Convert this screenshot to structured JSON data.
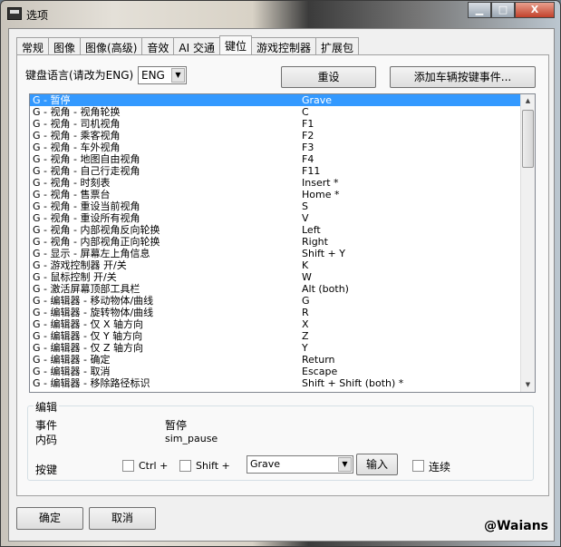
{
  "window": {
    "title": "选项",
    "minimize": "▁",
    "maximize": "□",
    "close": "X"
  },
  "tabs": [
    "常规",
    "图像",
    "图像(高级)",
    "音效",
    "AI 交通",
    "键位",
    "游戏控制器",
    "扩展包"
  ],
  "active_tab": 5,
  "keyboard_lang": {
    "label": "键盘语言(请改为ENG)",
    "value": "ENG"
  },
  "buttons": {
    "reset": "重设",
    "add_event": "添加车辆按键事件...",
    "ok": "确定",
    "cancel": "取消",
    "input": "输入"
  },
  "bindings": [
    {
      "name": "G - 暂停",
      "key": "Grave"
    },
    {
      "name": "G - 视角 - 视角轮换",
      "key": "C"
    },
    {
      "name": "G - 视角 - 司机视角",
      "key": "F1"
    },
    {
      "name": "G - 视角 - 乘客视角",
      "key": "F2"
    },
    {
      "name": "G - 视角 - 车外视角",
      "key": "F3"
    },
    {
      "name": "G - 视角 - 地图自由视角",
      "key": "F4"
    },
    {
      "name": "G - 视角 - 自己行走视角",
      "key": "F11"
    },
    {
      "name": "G - 视角 - 时刻表",
      "key": "Insert *"
    },
    {
      "name": "G - 视角 - 售票台",
      "key": "Home *"
    },
    {
      "name": "G - 视角 - 重设当前视角",
      "key": "S"
    },
    {
      "name": "G - 视角 - 重设所有视角",
      "key": "V"
    },
    {
      "name": "G - 视角 - 内部视角反向轮换",
      "key": "Left"
    },
    {
      "name": "G - 视角 - 内部视角正向轮换",
      "key": "Right"
    },
    {
      "name": "G - 显示 - 屏幕左上角信息",
      "key": "Shift + Y"
    },
    {
      "name": "G - 游戏控制器 开/关",
      "key": "K"
    },
    {
      "name": "G - 鼠标控制 开/关",
      "key": "W"
    },
    {
      "name": "G - 激活屏幕顶部工具栏",
      "key": "Alt (both)"
    },
    {
      "name": "G - 编辑器 - 移动物体/曲线",
      "key": "G"
    },
    {
      "name": "G - 编辑器 - 旋转物体/曲线",
      "key": "R"
    },
    {
      "name": "G - 编辑器 - 仅 X 轴方向",
      "key": "X"
    },
    {
      "name": "G - 编辑器 - 仅 Y 轴方向",
      "key": "Z"
    },
    {
      "name": "G - 编辑器 - 仅 Z 轴方向",
      "key": "Y"
    },
    {
      "name": "G - 编辑器 - 确定",
      "key": "Return"
    },
    {
      "name": "G - 编辑器 - 取消",
      "key": "Escape"
    },
    {
      "name": "G - 编辑器 - 移除路径标识",
      "key": "Shift + Shift (both) *"
    }
  ],
  "selected_index": 0,
  "edit": {
    "title": "编辑",
    "event_label": "事件",
    "event_value": "暂停",
    "code_label": "内码",
    "code_value": "sim_pause",
    "key_label": "按键",
    "ctrl": "Ctrl +",
    "shift": "Shift +",
    "key_value": "Grave",
    "repeat": "连续"
  },
  "watermark": "@Waians"
}
